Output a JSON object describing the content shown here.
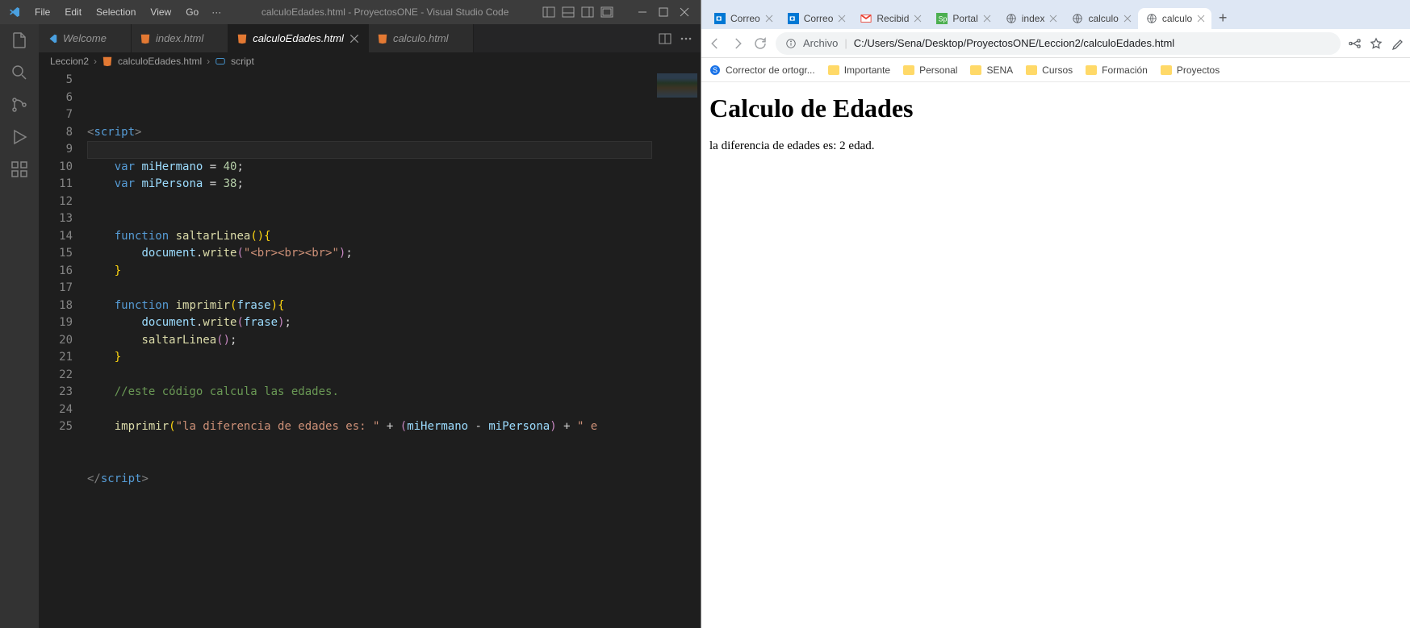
{
  "vscode": {
    "menu": [
      "File",
      "Edit",
      "Selection",
      "View",
      "Go"
    ],
    "menu_more": "···",
    "title": "calculoEdades.html - ProyectosONE - Visual Studio Code",
    "tabs": [
      {
        "label": "Welcome",
        "type": "vs"
      },
      {
        "label": "index.html",
        "type": "html"
      },
      {
        "label": "calculoEdades.html",
        "type": "html",
        "active": true
      },
      {
        "label": "calculo.html",
        "type": "html"
      }
    ],
    "breadcrumbs": [
      "Leccion2",
      "calculoEdades.html",
      "script"
    ],
    "lineStart": 5,
    "lineEnd": 25,
    "code": {
      "lines": [
        [
          {
            "c": "k-tag",
            "t": "<"
          },
          {
            "c": "k-blue",
            "t": "script"
          },
          {
            "c": "k-tag",
            "t": ">"
          }
        ],
        [],
        [
          {
            "c": "k-pun",
            "t": "    "
          },
          {
            "c": "k-blue",
            "t": "var"
          },
          {
            "c": "k-pun",
            "t": " "
          },
          {
            "c": "k-lblue",
            "t": "miHermano"
          },
          {
            "c": "k-pun",
            "t": " = "
          },
          {
            "c": "k-num",
            "t": "40"
          },
          {
            "c": "k-pun",
            "t": ";"
          }
        ],
        [
          {
            "c": "k-pun",
            "t": "    "
          },
          {
            "c": "k-blue",
            "t": "var"
          },
          {
            "c": "k-pun",
            "t": " "
          },
          {
            "c": "k-lblue",
            "t": "miPersona"
          },
          {
            "c": "k-pun",
            "t": " = "
          },
          {
            "c": "k-num",
            "t": "38"
          },
          {
            "c": "k-pun",
            "t": ";"
          }
        ],
        [],
        [],
        [
          {
            "c": "k-pun",
            "t": "    "
          },
          {
            "c": "k-blue",
            "t": "function"
          },
          {
            "c": "k-pun",
            "t": " "
          },
          {
            "c": "k-yel",
            "t": "saltarLinea"
          },
          {
            "c": "k-gold",
            "t": "()"
          },
          {
            "c": "k-gold",
            "t": "{"
          }
        ],
        [
          {
            "c": "k-pun",
            "t": "        "
          },
          {
            "c": "k-lblue",
            "t": "document"
          },
          {
            "c": "k-pun",
            "t": "."
          },
          {
            "c": "k-yel",
            "t": "write"
          },
          {
            "c": "k-pur",
            "t": "("
          },
          {
            "c": "k-str",
            "t": "\"<br><br><br>\""
          },
          {
            "c": "k-pur",
            "t": ")"
          },
          {
            "c": "k-pun",
            "t": ";"
          }
        ],
        [
          {
            "c": "k-pun",
            "t": "    "
          },
          {
            "c": "k-gold",
            "t": "}"
          }
        ],
        [],
        [
          {
            "c": "k-pun",
            "t": "    "
          },
          {
            "c": "k-blue",
            "t": "function"
          },
          {
            "c": "k-pun",
            "t": " "
          },
          {
            "c": "k-yel",
            "t": "imprimir"
          },
          {
            "c": "k-gold",
            "t": "("
          },
          {
            "c": "k-lblue",
            "t": "frase"
          },
          {
            "c": "k-gold",
            "t": ")"
          },
          {
            "c": "k-gold",
            "t": "{"
          }
        ],
        [
          {
            "c": "k-pun",
            "t": "        "
          },
          {
            "c": "k-lblue",
            "t": "document"
          },
          {
            "c": "k-pun",
            "t": "."
          },
          {
            "c": "k-yel",
            "t": "write"
          },
          {
            "c": "k-pur",
            "t": "("
          },
          {
            "c": "k-lblue",
            "t": "frase"
          },
          {
            "c": "k-pur",
            "t": ")"
          },
          {
            "c": "k-pun",
            "t": ";"
          }
        ],
        [
          {
            "c": "k-pun",
            "t": "        "
          },
          {
            "c": "k-yel",
            "t": "saltarLinea"
          },
          {
            "c": "k-pur",
            "t": "()"
          },
          {
            "c": "k-pun",
            "t": ";"
          }
        ],
        [
          {
            "c": "k-pun",
            "t": "    "
          },
          {
            "c": "k-gold",
            "t": "}"
          }
        ],
        [],
        [
          {
            "c": "k-pun",
            "t": "    "
          },
          {
            "c": "k-com",
            "t": "//este código calcula las edades."
          }
        ],
        [],
        [
          {
            "c": "k-pun",
            "t": "    "
          },
          {
            "c": "k-yel",
            "t": "imprimir"
          },
          {
            "c": "k-gold",
            "t": "("
          },
          {
            "c": "k-str",
            "t": "\"la diferencia de edades es: \""
          },
          {
            "c": "k-pun",
            "t": " + "
          },
          {
            "c": "k-pur",
            "t": "("
          },
          {
            "c": "k-lblue",
            "t": "miHermano"
          },
          {
            "c": "k-pun",
            "t": " - "
          },
          {
            "c": "k-lblue",
            "t": "miPersona"
          },
          {
            "c": "k-pur",
            "t": ")"
          },
          {
            "c": "k-pun",
            "t": " + "
          },
          {
            "c": "k-str",
            "t": "\" e"
          }
        ],
        [],
        [],
        [
          {
            "c": "k-tag",
            "t": "</"
          },
          {
            "c": "k-blue",
            "t": "script"
          },
          {
            "c": "k-tag",
            "t": ">"
          }
        ]
      ]
    }
  },
  "chrome": {
    "tabs": [
      {
        "label": "Correo",
        "favicon": "outlook"
      },
      {
        "label": "Correo",
        "favicon": "outlook"
      },
      {
        "label": "Recibid",
        "favicon": "gmail"
      },
      {
        "label": "Portal",
        "favicon": "sp"
      },
      {
        "label": "index",
        "favicon": "globe"
      },
      {
        "label": "calculo",
        "favicon": "globe"
      },
      {
        "label": "calculo",
        "favicon": "globe",
        "active": true
      }
    ],
    "url_label": "Archivo",
    "url": "C:/Users/Sena/Desktop/ProyectosONE/Leccion2/calculoEdades.html",
    "bookmarks": [
      {
        "label": "Corrector de ortogr...",
        "icon": "s"
      },
      {
        "label": "Importante",
        "icon": "folder"
      },
      {
        "label": "Personal",
        "icon": "folder"
      },
      {
        "label": "SENA",
        "icon": "folder"
      },
      {
        "label": "Cursos",
        "icon": "folder"
      },
      {
        "label": "Formación",
        "icon": "folder"
      },
      {
        "label": "Proyectos",
        "icon": "folder"
      }
    ],
    "page": {
      "heading": "Calculo de Edades",
      "text": "la diferencia de edades es: 2 edad."
    }
  }
}
